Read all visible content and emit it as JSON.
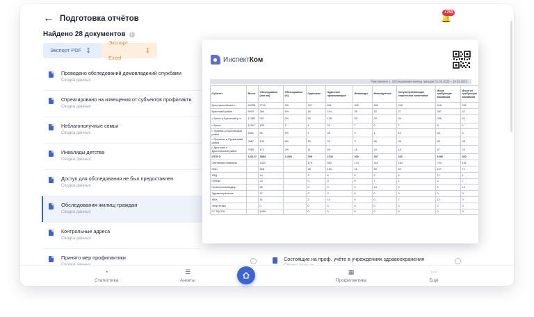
{
  "header": {
    "back_icon": "arrow-left-icon",
    "title": "Подготовка отчётов"
  },
  "notifications": {
    "badge": "+750",
    "icon": "bell-icon"
  },
  "results": {
    "found_text": "Найдено 28 документов"
  },
  "export": {
    "pdf_label": "Экспорт PDF",
    "excel_label": "Экспорт Excel"
  },
  "documents": [
    {
      "name": "Проведено обследований домовладений службами",
      "sub": "Сводка данных"
    },
    {
      "name": "Отреагировано на извещения от субъектов профилакти",
      "sub": "Сводка данных"
    },
    {
      "name": "Неблагополучные семьи",
      "sub": "Сводка данных"
    },
    {
      "name": "Инвалиды детства",
      "sub": "Сводка данных"
    },
    {
      "name": "Доступ для обследования не был предоставлен",
      "sub": "Сводка данных"
    },
    {
      "name": "Обследования жилищ граждан",
      "sub": "Сводка данных",
      "active": true
    },
    {
      "name": "Контрольные адреса",
      "sub": "Сводка данных"
    },
    {
      "name": "Принято мер профилактики",
      "sub": "Сводка данных"
    }
  ],
  "right_document": {
    "name": "Состоящие на проф. учёте в учреждениях здравоохранения",
    "sub": "Сводка данных"
  },
  "preview": {
    "logo_prefix": "Инспект",
    "logo_bold": "Ком",
    "sheet_title": "Приложение 1. Обследования жилищ граждан 01.03.2023 – 28.03.2023",
    "columns": [
      "Субъект",
      "Всего",
      "Обследовано (кол-во)",
      "Обследовано (%)",
      "Одинокие",
      "Одинокое проживающие",
      "Инвалиды",
      "Многодетные",
      "Злоупотребляющие спиртными напитками",
      "Иные требующие внимания",
      "Иные не требующие внимания"
    ],
    "rows": [
      [
        "Брестская область",
        "94755",
        "2710",
        "3%",
        "197",
        "691",
        "202",
        "160",
        "216",
        "916",
        "291"
      ],
      [
        "Брестский район",
        "5910",
        "284",
        "4%",
        "18",
        "104",
        "29",
        "33",
        "27",
        "287",
        "42"
      ],
      [
        "г. Брест и Брестский р-н",
        "17482",
        "397",
        "2%",
        "33",
        "128",
        "36",
        "33",
        "34",
        "295",
        "42"
      ],
      [
        "г. Брест",
        "11547",
        "133",
        "3",
        "4",
        "22",
        "7",
        "0",
        "7",
        "8",
        "0"
      ],
      [
        "г. Лунинец и Лунинецкий район",
        "2551",
        "65",
        "2%",
        "7",
        "28",
        "5",
        "1",
        "12",
        "28",
        "4"
      ],
      [
        "г. Пружаны и Пружанский район",
        "3387",
        "143",
        "8%",
        "15",
        "22",
        "3",
        "36",
        "35",
        "59",
        "28"
      ],
      [
        "г. Дрогичин и Дрогичинский район",
        "7065",
        "172",
        "2%",
        "11",
        "69",
        "18",
        "24",
        "18",
        "47",
        "23"
      ],
      [
        "ИТОГО",
        "141127",
        "3884",
        "2.25%",
        "299",
        "1032",
        "300",
        "287",
        "332",
        "1690",
        "402"
      ],
      [
        "Светлиная инвизсия",
        "",
        "1331",
        "",
        "176",
        "553",
        "174",
        "118",
        "164",
        "794",
        "191"
      ],
      [
        "МЧС",
        "",
        "458",
        "",
        "28",
        "193",
        "41",
        "59",
        "40",
        "127",
        "71"
      ],
      [
        "УВД",
        "",
        "14",
        "",
        "2",
        "8",
        "0",
        "0",
        "4",
        "17",
        "1"
      ],
      [
        "Облгаз",
        "",
        "23",
        "",
        "0",
        "0",
        "0",
        "7",
        "1",
        "3",
        "7"
      ],
      [
        "Госэнергогазнадзор",
        "",
        "26",
        "",
        "0",
        "0",
        "2",
        "14",
        "0",
        "6",
        "14"
      ],
      [
        "Здравоохранение",
        "",
        "37",
        "",
        "0",
        "0",
        "0",
        "0",
        "0",
        "0",
        "0"
      ],
      [
        "ЖКХ",
        "",
        "31",
        "",
        "2",
        "14",
        "5",
        "0",
        "7",
        "12",
        "0"
      ],
      [
        "Энергетика",
        "",
        "0",
        "",
        "0",
        "0",
        "0",
        "0",
        "0",
        "0",
        "0"
      ],
      [
        "ГУ ТЦСОН",
        "",
        "1069",
        "",
        "0",
        "0",
        "0",
        "0",
        "0",
        "0",
        "0"
      ]
    ]
  },
  "bottom_nav": [
    {
      "label": "Статистика",
      "icon": "pie-chart-icon"
    },
    {
      "label": "Анкеты",
      "icon": "checklist-icon"
    },
    {
      "label": "",
      "icon": "home-icon"
    },
    {
      "label": "Профилактика",
      "icon": "clipboard-icon"
    },
    {
      "label": "Ещё",
      "icon": "more-dots-icon"
    }
  ],
  "colors": {
    "accent": "#3d63d4",
    "pdf_bg": "#e6edfc",
    "excel_bg": "#fdeedd",
    "badge": "#e0374a"
  }
}
